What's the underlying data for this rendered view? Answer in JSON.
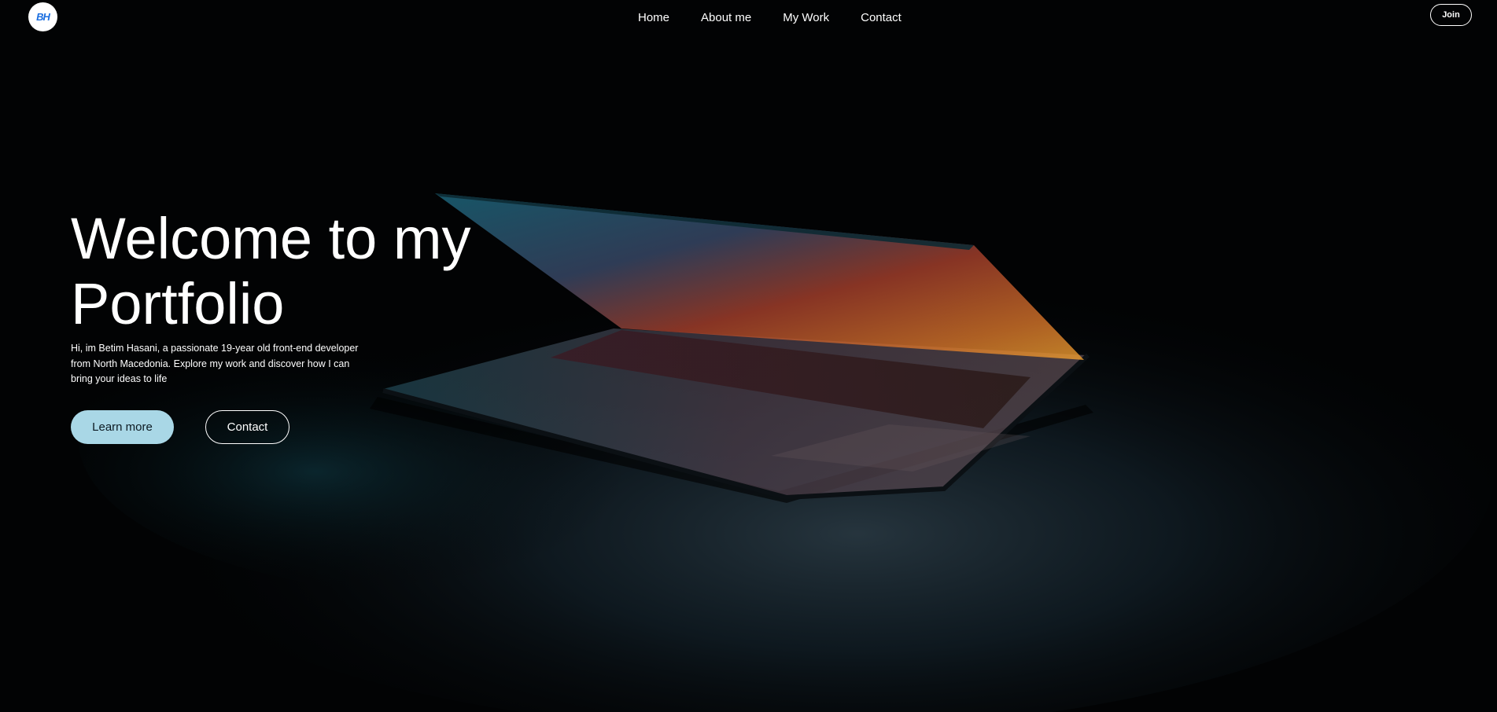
{
  "header": {
    "logo_text": "BH",
    "nav": [
      {
        "label": "Home"
      },
      {
        "label": "About me"
      },
      {
        "label": "My Work"
      },
      {
        "label": "Contact"
      }
    ],
    "join_label": "Join"
  },
  "hero": {
    "title_line1": "Welcome to my",
    "title_line2": "Portfolio",
    "description": "Hi, im Betim Hasani, a passionate 19-year old front-end developer from North Macedonia. Explore my work and discover how I can bring your ideas to life",
    "learn_more_label": "Learn more",
    "contact_label": "Contact"
  },
  "colors": {
    "background": "#020304",
    "accent_button": "#a9d7e6",
    "logo_text": "#1c6fe0",
    "text": "#ffffff"
  }
}
